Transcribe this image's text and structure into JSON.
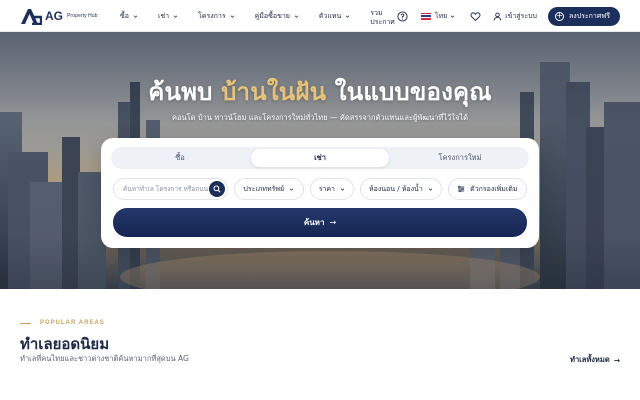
{
  "brand": {
    "logo_text": "AG",
    "logo_sub": "Property Hub"
  },
  "nav": {
    "items": [
      {
        "label": "ซื้อ"
      },
      {
        "label": "เช่า"
      },
      {
        "label": "โครงการ"
      },
      {
        "label": "คู่มือซื้อขาย"
      },
      {
        "label": "ตัวแทน"
      }
    ],
    "announce_line1": "รวม",
    "announce_line2": "ประกาศ",
    "language": "ไทย",
    "login": "เข้าสู่ระบบ",
    "post_free": "ลงประกาศฟรี"
  },
  "hero": {
    "title_part1": "ค้นพบ ",
    "title_accent": "บ้านในฝัน",
    "title_part2": " ในแบบของคุณ",
    "subtitle": "คอนโด บ้าน ทาวน์โฮม และโครงการใหม่ทั่วไทย — คัดสรรจากตัวแทนและผู้พัฒนาที่ไว้ใจได้"
  },
  "search": {
    "tabs": [
      {
        "label": "ซื้อ",
        "active": false
      },
      {
        "label": "เช่า",
        "active": true
      },
      {
        "label": "โครงการใหม่",
        "active": false
      }
    ],
    "placeholder": "ค้นหาทำเล โครงการ หรือถนน",
    "property_type": "ประเภททรัพย์",
    "price": "ราคา",
    "rooms": "ห้องนอน / ห้องน้ำ",
    "more_filters": "ตัวกรองเพิ่มเติม",
    "submit": "ค้นหา"
  },
  "popular": {
    "eyebrow": "POPULAR AREAS",
    "title": "ทำเลยอดนิยม",
    "subtitle": "ทำเลที่คนไทยและชาวต่างชาติค้นหามากที่สุดบน AG",
    "see_all": "ทำเลทั้งหมด"
  },
  "colors": {
    "navy": "#1c2e5a",
    "gold": "#c9a35c",
    "gold_accent": "#e6c27a"
  }
}
